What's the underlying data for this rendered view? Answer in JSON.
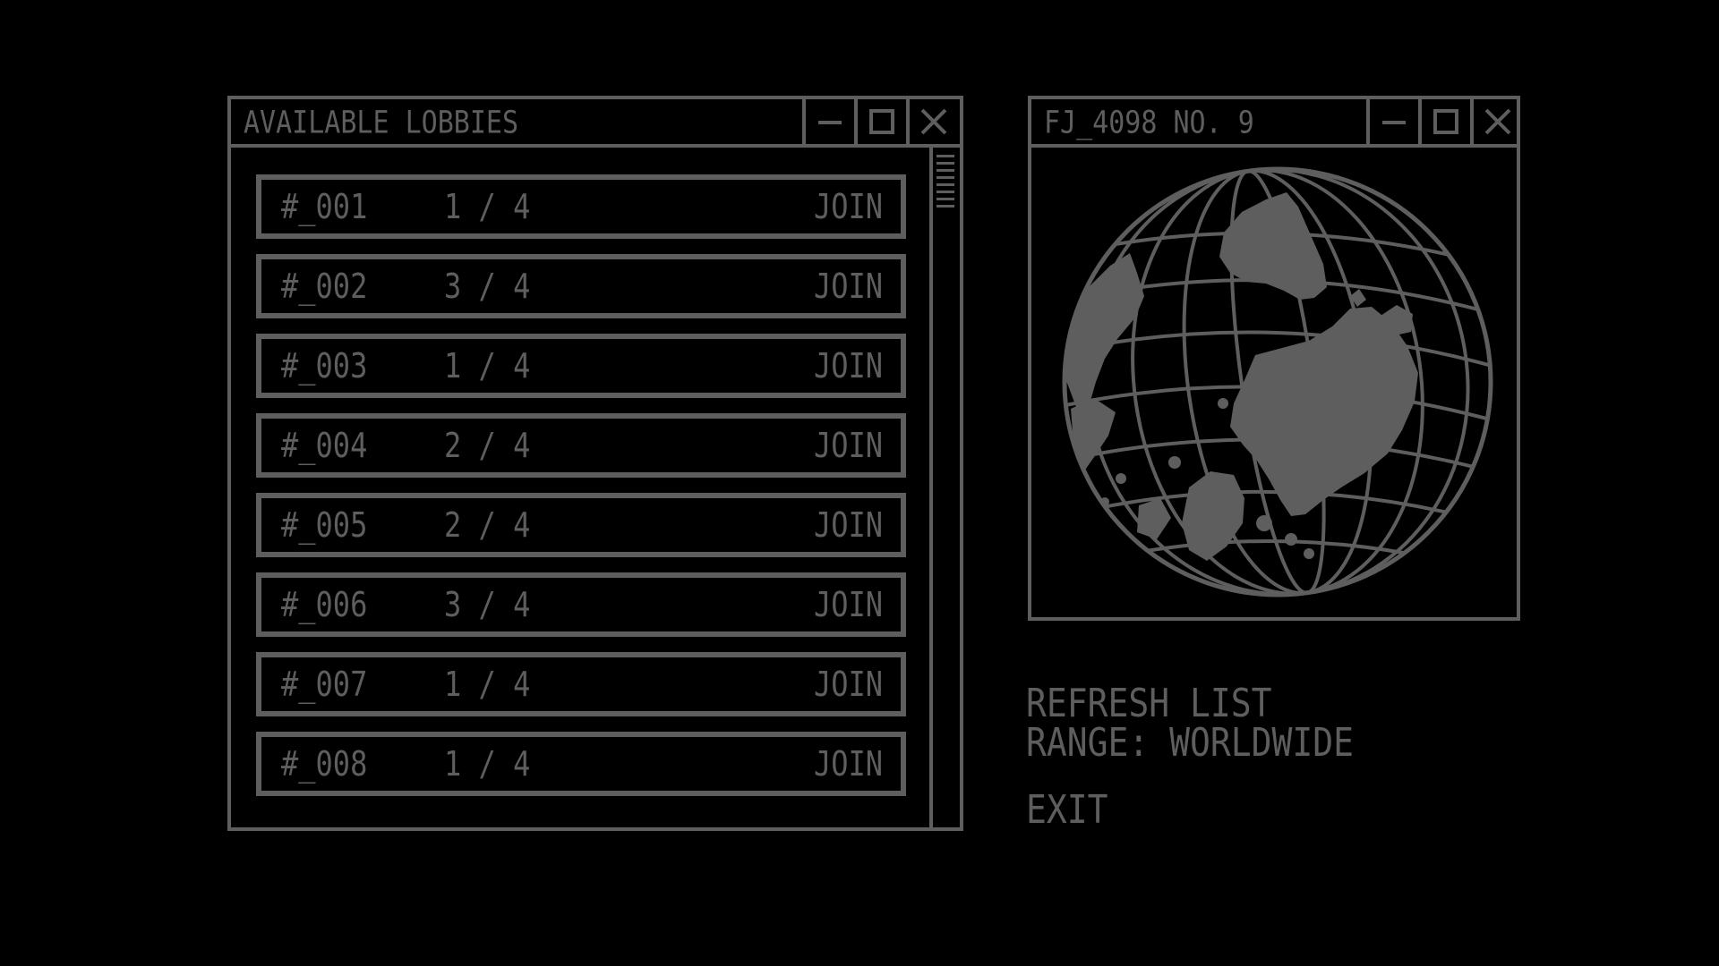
{
  "lobbies_window": {
    "title": "AVAILABLE LOBBIES",
    "rows": [
      {
        "id": "#_001",
        "players": "1 / 4",
        "action": "JOIN"
      },
      {
        "id": "#_002",
        "players": "3 / 4",
        "action": "JOIN"
      },
      {
        "id": "#_003",
        "players": "1 / 4",
        "action": "JOIN"
      },
      {
        "id": "#_004",
        "players": "2 / 4",
        "action": "JOIN"
      },
      {
        "id": "#_005",
        "players": "2 / 4",
        "action": "JOIN"
      },
      {
        "id": "#_006",
        "players": "3 / 4",
        "action": "JOIN"
      },
      {
        "id": "#_007",
        "players": "1 / 4",
        "action": "JOIN"
      },
      {
        "id": "#_008",
        "players": "1 / 4",
        "action": "JOIN"
      }
    ]
  },
  "globe_window": {
    "title": "FJ_4098 NO. 9",
    "icon": "globe-icon"
  },
  "menu": {
    "refresh": "REFRESH LIST",
    "range": "RANGE: WORLDWIDE",
    "exit": "EXIT"
  },
  "colors": {
    "background": "#000000",
    "foreground": "#5e5e5e"
  }
}
